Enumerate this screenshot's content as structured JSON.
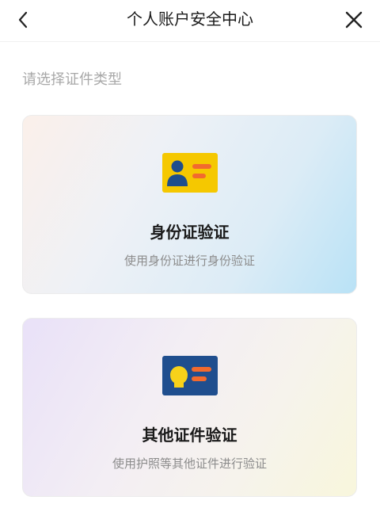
{
  "header": {
    "title": "个人账户安全中心",
    "back_icon": "chevron-left-icon",
    "close_icon": "close-icon"
  },
  "prompt": "请选择证件类型",
  "cards": [
    {
      "title": "身份证验证",
      "subtitle": "使用身份证进行身份验证",
      "icon": "id-card-icon"
    },
    {
      "title": "其他证件验证",
      "subtitle": "使用护照等其他证件进行验证",
      "icon": "document-card-icon"
    }
  ],
  "colors": {
    "id_card_yellow": "#F5C800",
    "id_card_blue": "#1E4E8C",
    "accent_orange": "#F26A2E",
    "doc_card_blue": "#1F4E8E",
    "doc_card_yellow": "#F7D21A"
  }
}
